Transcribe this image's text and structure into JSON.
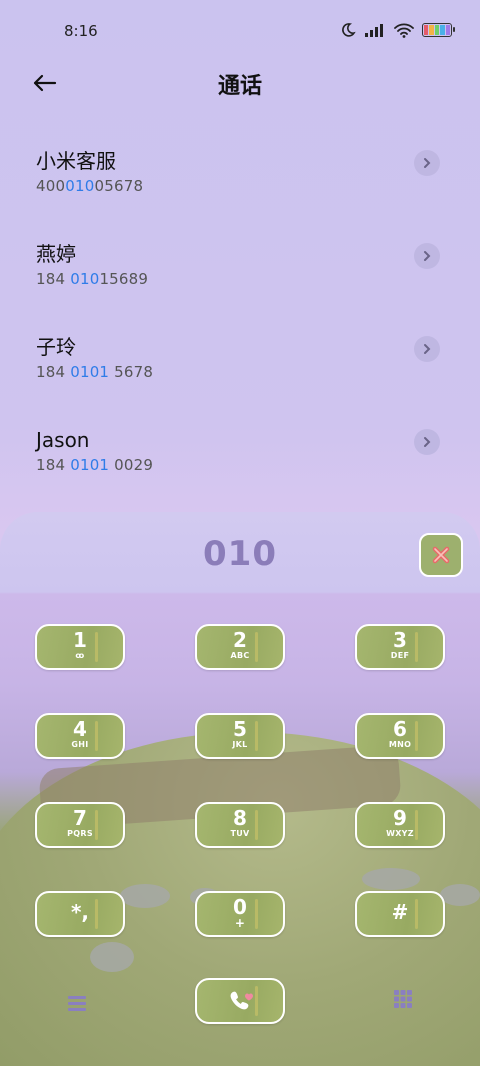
{
  "status": {
    "time": "8:16"
  },
  "header": {
    "title": "通话"
  },
  "contacts": [
    {
      "name": "小米客服",
      "num_pre": "400",
      "num_hl": "010",
      "num_post": "05678"
    },
    {
      "name": "燕婷",
      "num_pre": "184 ",
      "num_hl": "010",
      "num_post": "15689"
    },
    {
      "name": "子玲",
      "num_pre": "184 ",
      "num_hl": "0101",
      "num_post": " 5678"
    },
    {
      "name": "Jason",
      "num_pre": "184 ",
      "num_hl": "0101",
      "num_post": " 0029"
    }
  ],
  "dialer": {
    "display": "010",
    "keys": [
      {
        "digit": "1",
        "letters": "ꝏ"
      },
      {
        "digit": "2",
        "letters": "ABC"
      },
      {
        "digit": "3",
        "letters": "DEF"
      },
      {
        "digit": "4",
        "letters": "GHI"
      },
      {
        "digit": "5",
        "letters": "JKL"
      },
      {
        "digit": "6",
        "letters": "MNO"
      },
      {
        "digit": "7",
        "letters": "PQRS"
      },
      {
        "digit": "8",
        "letters": "TUV"
      },
      {
        "digit": "9",
        "letters": "WXYZ"
      },
      {
        "digit": "*,",
        "letters": ""
      },
      {
        "digit": "0",
        "letters": "+"
      },
      {
        "digit": "#",
        "letters": ""
      }
    ]
  },
  "colors": {
    "highlight": "#2f7ce8",
    "display": "#8b7db9",
    "key_bg": "#9fb068"
  },
  "icons": [
    "back-arrow-icon",
    "moon-icon",
    "signal-icon",
    "wifi-icon",
    "battery-icon",
    "chevron-right-icon",
    "delete-icon",
    "voicemail-icon",
    "menu-icon",
    "call-icon",
    "keypad-icon"
  ]
}
